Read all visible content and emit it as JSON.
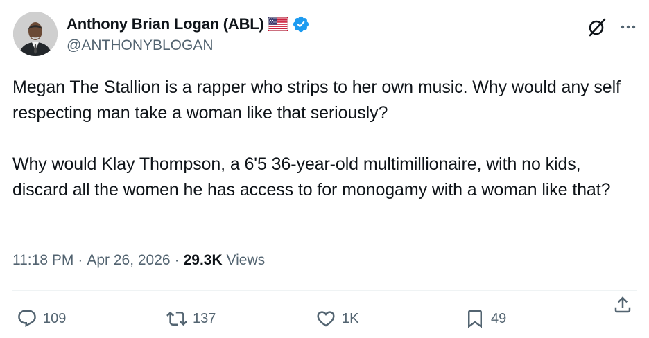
{
  "author": {
    "display_name": "Anthony Brian Logan (ABL)",
    "handle": "@ANTHONYBLOGAN",
    "flag_icon": "us-flag-icon",
    "verified_icon": "verified-badge-icon",
    "verified_color": "#1d9bf0"
  },
  "header_actions": {
    "grok_icon": "grok-icon",
    "more_icon": "more-options-icon"
  },
  "tweet": {
    "paragraphs": [
      "Megan The Stallion is a rapper who strips to her own music. Why would any self respecting man take a woman like that seriously?",
      "Why would Klay Thompson, a 6'5 36-year-old multimillionaire, with no kids, discard all the women he has access to for monogamy with a woman like that?"
    ],
    "time": "11:18 PM",
    "date": "Apr 26, 2026",
    "separator": "·",
    "views_count": "29.3K",
    "views_label": "Views"
  },
  "actions": {
    "reply_count": "109",
    "repost_count": "137",
    "like_count": "1K",
    "bookmark_count": "49"
  },
  "colors": {
    "text_primary": "#0f1419",
    "text_secondary": "#536471",
    "divider": "#eff3f4"
  }
}
